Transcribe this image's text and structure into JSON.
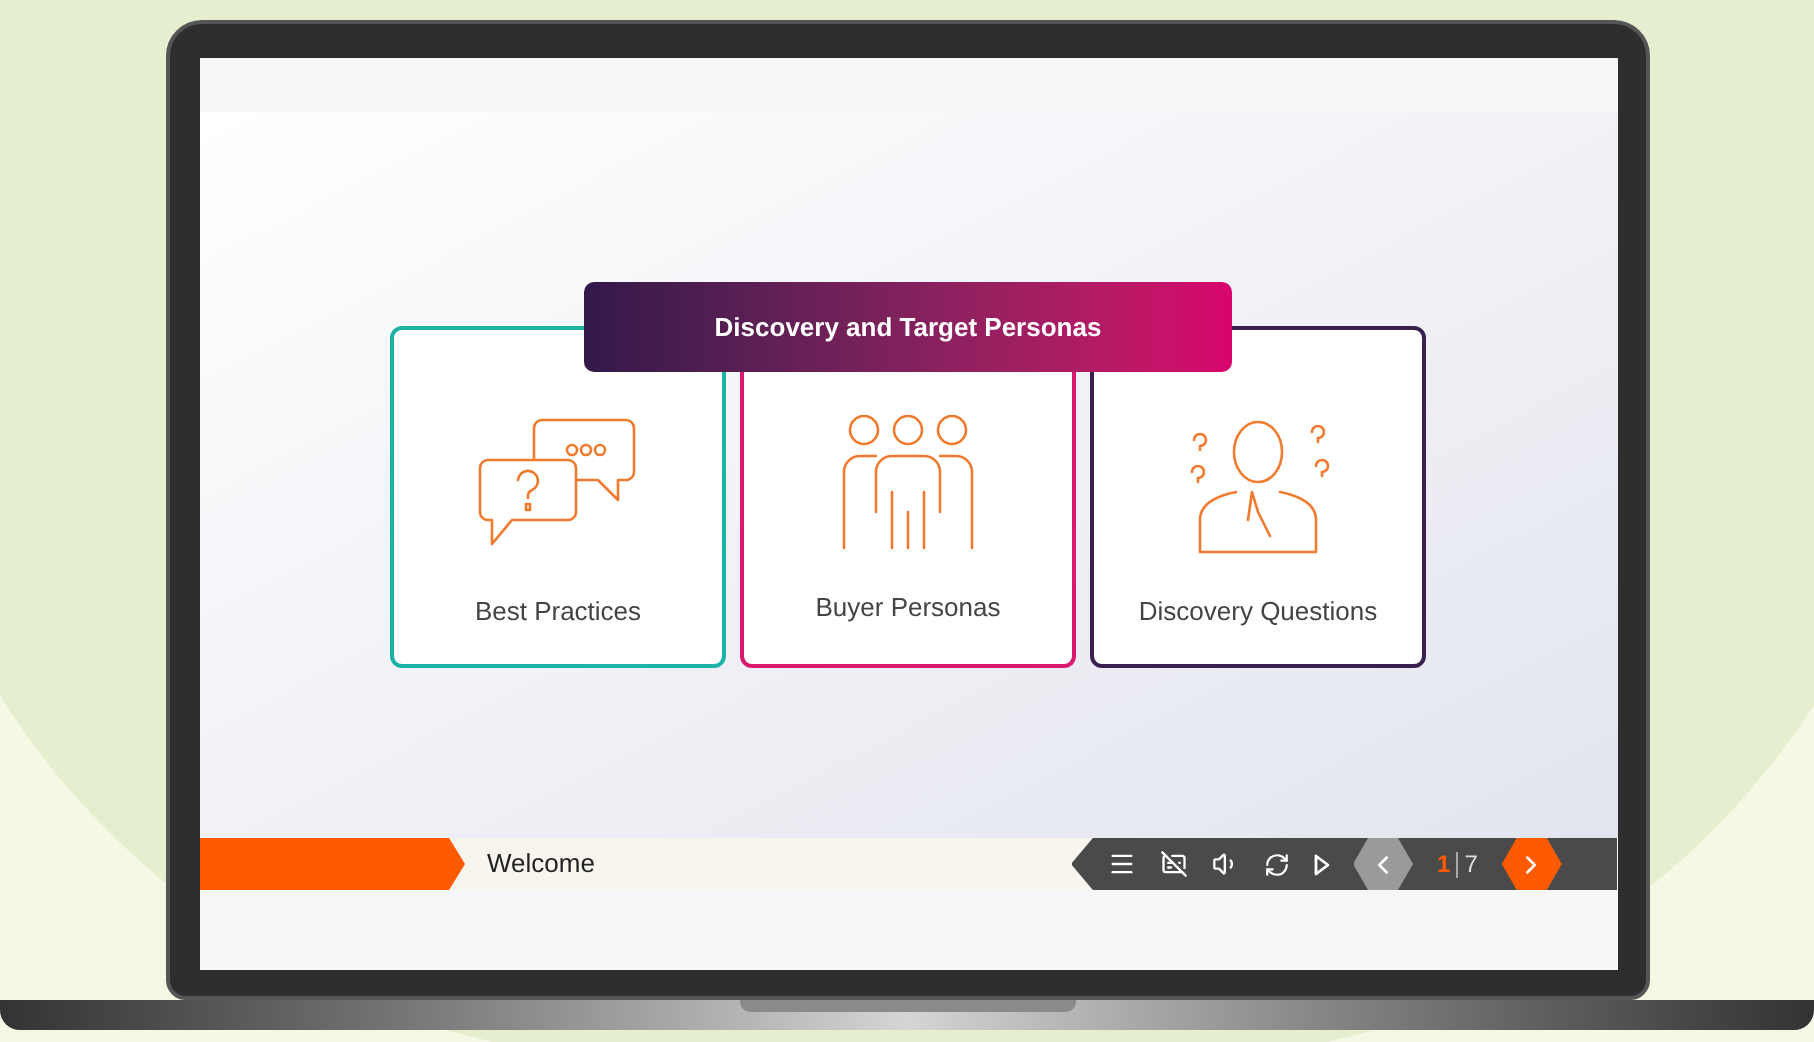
{
  "slide": {
    "title": "Discovery and Target Personas",
    "cards": [
      {
        "kind": "chat",
        "label": "Best Practices",
        "color": "#1ab3a6"
      },
      {
        "kind": "people",
        "label": "Buyer Personas",
        "color": "#d8196e"
      },
      {
        "kind": "thinker",
        "label": "Discovery Questions",
        "color": "#3a1f4f"
      }
    ]
  },
  "player_bar": {
    "slide_title": "Welcome",
    "current_slide": "1",
    "total_slides": "7",
    "prev_disabled": true
  }
}
